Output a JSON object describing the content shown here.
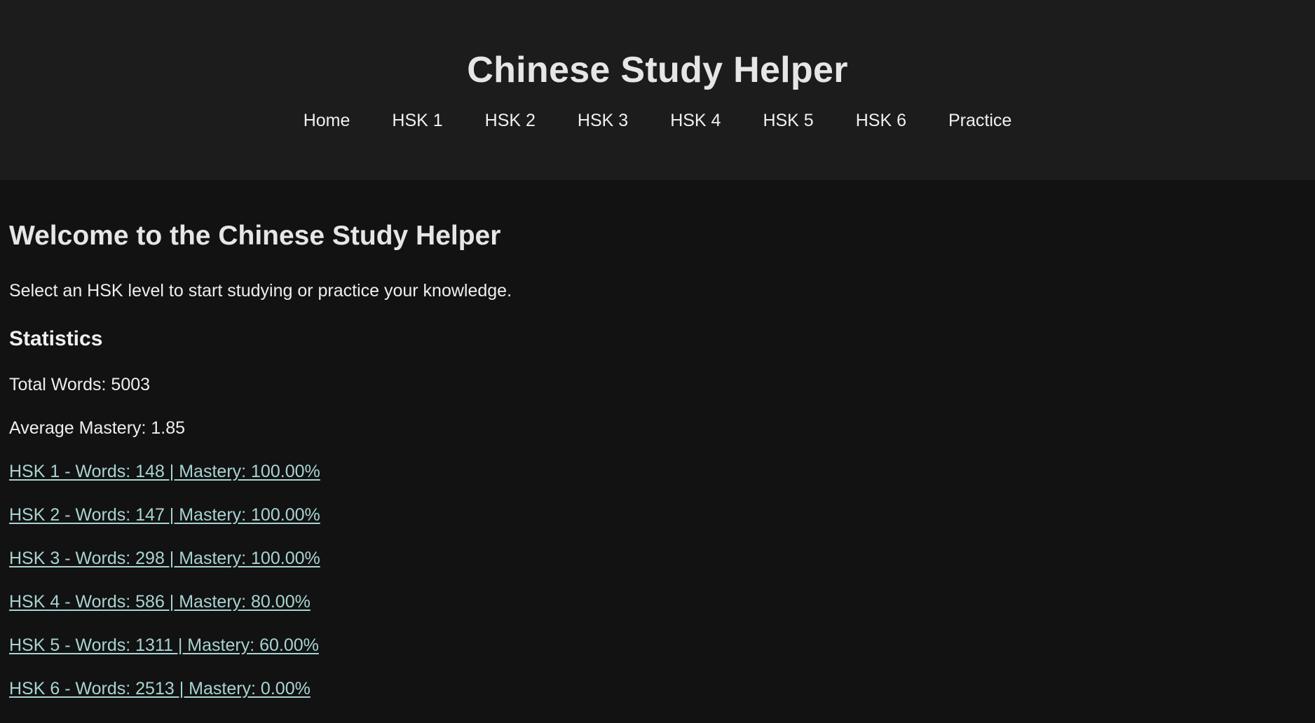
{
  "header": {
    "title": "Chinese Study Helper",
    "nav": [
      {
        "label": "Home"
      },
      {
        "label": "HSK 1"
      },
      {
        "label": "HSK 2"
      },
      {
        "label": "HSK 3"
      },
      {
        "label": "HSK 4"
      },
      {
        "label": "HSK 5"
      },
      {
        "label": "HSK 6"
      },
      {
        "label": "Practice"
      }
    ]
  },
  "main": {
    "welcome_title": "Welcome to the Chinese Study Helper",
    "intro": "Select an HSK level to start studying or practice your knowledge.",
    "statistics": {
      "title": "Statistics",
      "total_words": "Total Words: 5003",
      "average_mastery": "Average Mastery: 1.85",
      "levels": [
        {
          "label": "HSK 1 - Words: 148 | Mastery: 100.00%"
        },
        {
          "label": "HSK 2 - Words: 147 | Mastery: 100.00%"
        },
        {
          "label": "HSK 3 - Words: 298 | Mastery: 100.00%"
        },
        {
          "label": "HSK 4 - Words: 586 | Mastery: 80.00%"
        },
        {
          "label": "HSK 5 - Words: 1311 | Mastery: 60.00%"
        },
        {
          "label": "HSK 6 - Words: 2513 | Mastery: 0.00%"
        }
      ]
    }
  },
  "colors": {
    "page_background": "#121212",
    "header_background": "#1c1c1c",
    "text": "#e8e8e8",
    "link": "#a8d4d2"
  }
}
